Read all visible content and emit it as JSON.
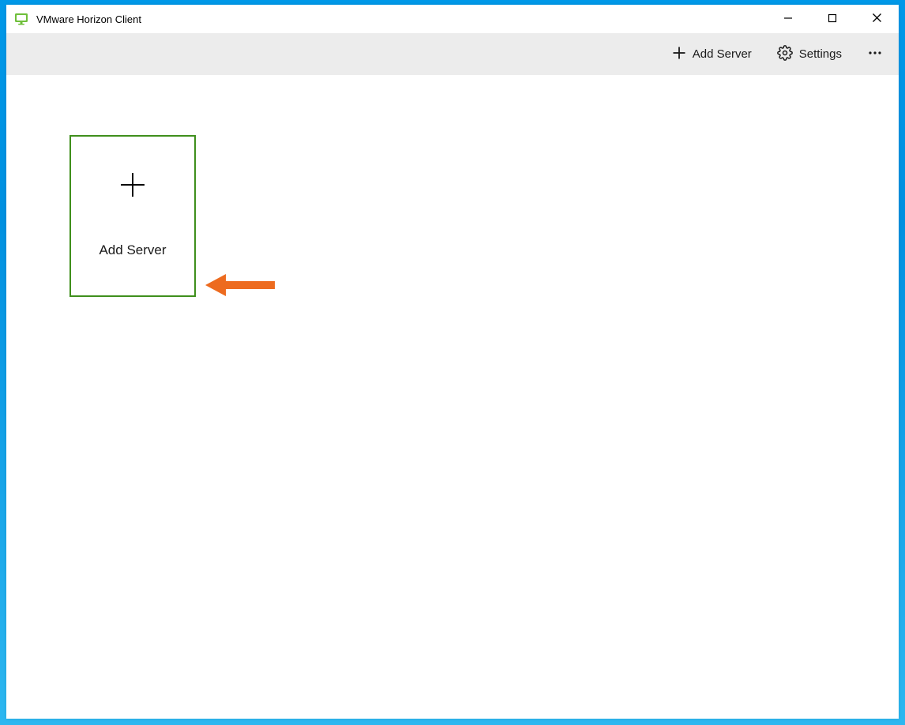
{
  "window": {
    "title": "VMware Horizon Client"
  },
  "toolbar": {
    "add_server_label": "Add Server",
    "settings_label": "Settings"
  },
  "main": {
    "tile_label": "Add Server"
  }
}
